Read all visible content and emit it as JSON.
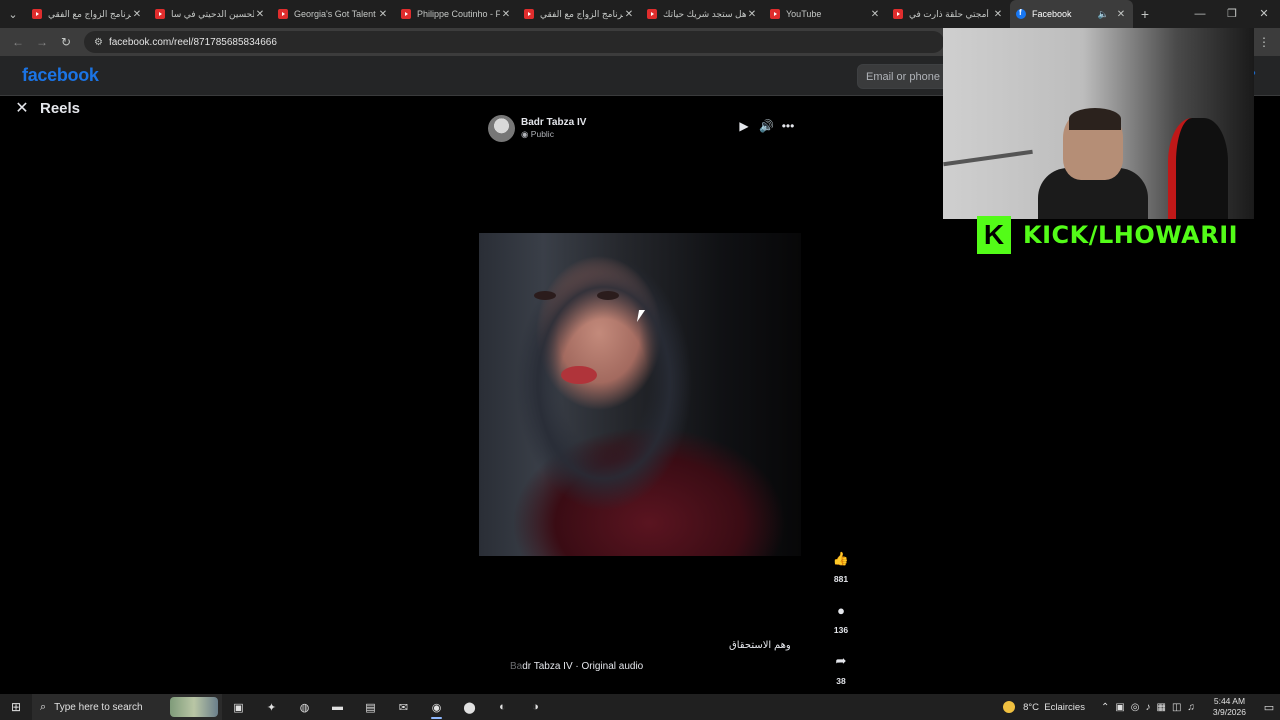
{
  "browser": {
    "tabs": [
      {
        "title": "برنامج الزواج مع الفقي",
        "favicon": "youtube-icon",
        "active": false
      },
      {
        "title": "الحسين الدحيتي في سا",
        "favicon": "youtube-icon",
        "active": false
      },
      {
        "title": "Georgia's Got Talent",
        "favicon": "youtube-icon",
        "active": false
      },
      {
        "title": "Philippe Coutinho - F",
        "favicon": "youtube-icon",
        "active": false
      },
      {
        "title": "برنامج الزواج مع الفقي",
        "favicon": "youtube-icon",
        "active": false
      },
      {
        "title": "هل ستجد شريك حياتك",
        "favicon": "youtube-icon",
        "active": false
      },
      {
        "title": "YouTube",
        "favicon": "youtube-icon",
        "active": false
      },
      {
        "title": "أمجتي حلقة ذارت في",
        "favicon": "youtube-icon",
        "active": false
      },
      {
        "title": "Facebook",
        "favicon": "facebook-icon",
        "active": true
      }
    ],
    "url": "facebook.com/reel/871785685834666"
  },
  "facebook": {
    "logo": "facebook",
    "email_placeholder": "Email or phone",
    "help": "?"
  },
  "reels": {
    "title": "Reels",
    "author_name": "Badr Tabza IV",
    "visibility": "Public",
    "likes": "881",
    "comments": "136",
    "shares": "38",
    "caption": "وهم الاستحقاق",
    "audio_prefix": "Ba",
    "audio": "dr Tabza IV · Original audio"
  },
  "overlay": {
    "kick_text": "KICK/LHOWARII",
    "kick_logo": "K",
    "kick_color": "#53fc18"
  },
  "taskbar": {
    "search_placeholder": "Type here to search",
    "temperature": "8°C",
    "weather": "Eclaircies",
    "time": "5:44 AM",
    "date": "3/9/2026"
  },
  "colors": {
    "facebook_blue": "#1b74e4",
    "background": "#000000"
  }
}
